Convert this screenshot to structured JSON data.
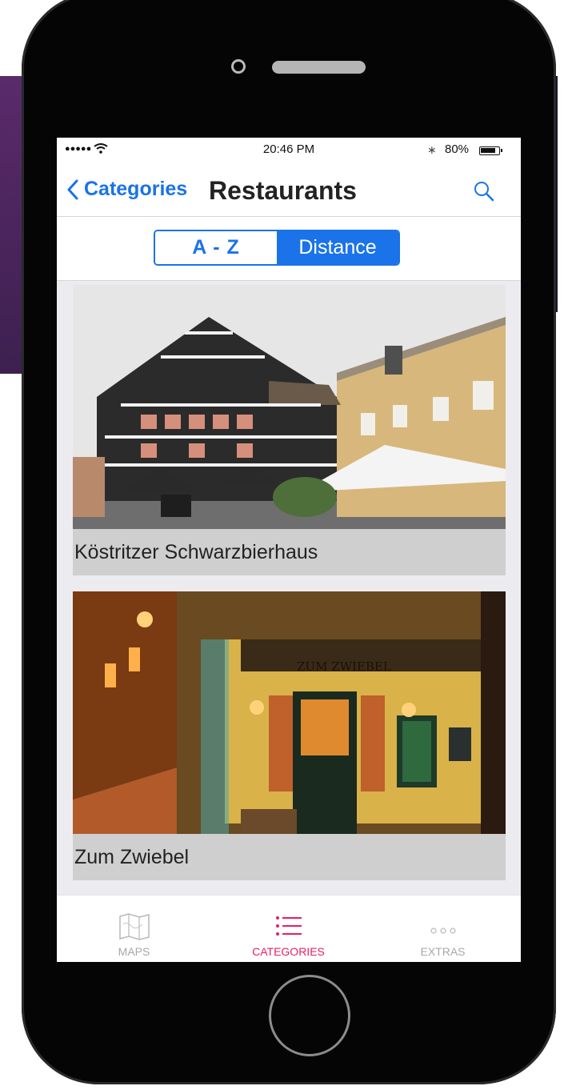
{
  "status_bar": {
    "signal": "●●●●●",
    "time": "20:46 PM",
    "bluetooth": "∗",
    "battery": "80%",
    "icons": [
      "signal-icon",
      "wifi-icon",
      "bluetooth-icon",
      "battery-icon"
    ]
  },
  "nav": {
    "back_label": "Categories",
    "title": "Restaurants",
    "icons": [
      "chevron-left-icon",
      "search-icon"
    ]
  },
  "segment": {
    "options": [
      "A - Z",
      "Distance"
    ],
    "selected": "Distance"
  },
  "restaurants": [
    {
      "name": "Köstritzer Schwarzbierhaus"
    },
    {
      "name": "Zum Zwiebel",
      "sign_text": "ZUM ZWIEBEL"
    }
  ],
  "tabs": [
    {
      "label": "MAPS",
      "icon": "map-icon"
    },
    {
      "label": "CATEGORIES",
      "icon": "list-icon",
      "active": true
    },
    {
      "label": "EXTRAS",
      "icon": "more-dots-icon"
    }
  ],
  "colors": {
    "accent": "#1a73e8",
    "active_tab": "#e61e64",
    "phone_body": "#050505",
    "background_purple": "#4a2660"
  }
}
